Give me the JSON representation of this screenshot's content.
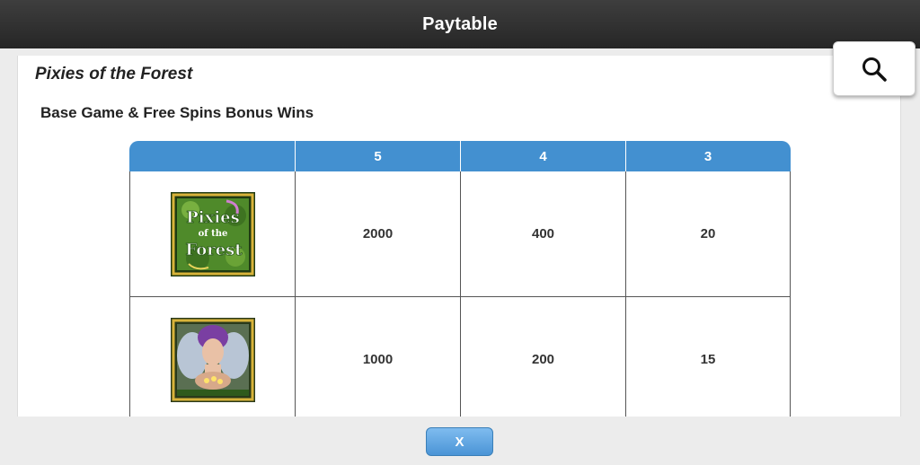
{
  "header": {
    "title": "Paytable"
  },
  "panel": {
    "game_title": "Pixies of the Forest",
    "section_title": "Base Game & Free Spins Bonus Wins"
  },
  "paytable": {
    "columns": [
      "",
      "5",
      "4",
      "3"
    ],
    "rows": [
      {
        "symbol": "pixies-of-the-forest-logo-symbol",
        "symbol_text": [
          "Pixies",
          "of the",
          "Forest"
        ],
        "values": [
          "2000",
          "400",
          "20"
        ]
      },
      {
        "symbol": "fairy-symbol",
        "values": [
          "1000",
          "200",
          "15"
        ]
      }
    ]
  },
  "toolbar": {
    "search_icon": "search-icon"
  },
  "footer": {
    "close_label": "X"
  },
  "colors": {
    "header_bg": "#2e2e2e",
    "table_header": "#4390d0",
    "close_button": "#5ea3e0"
  }
}
